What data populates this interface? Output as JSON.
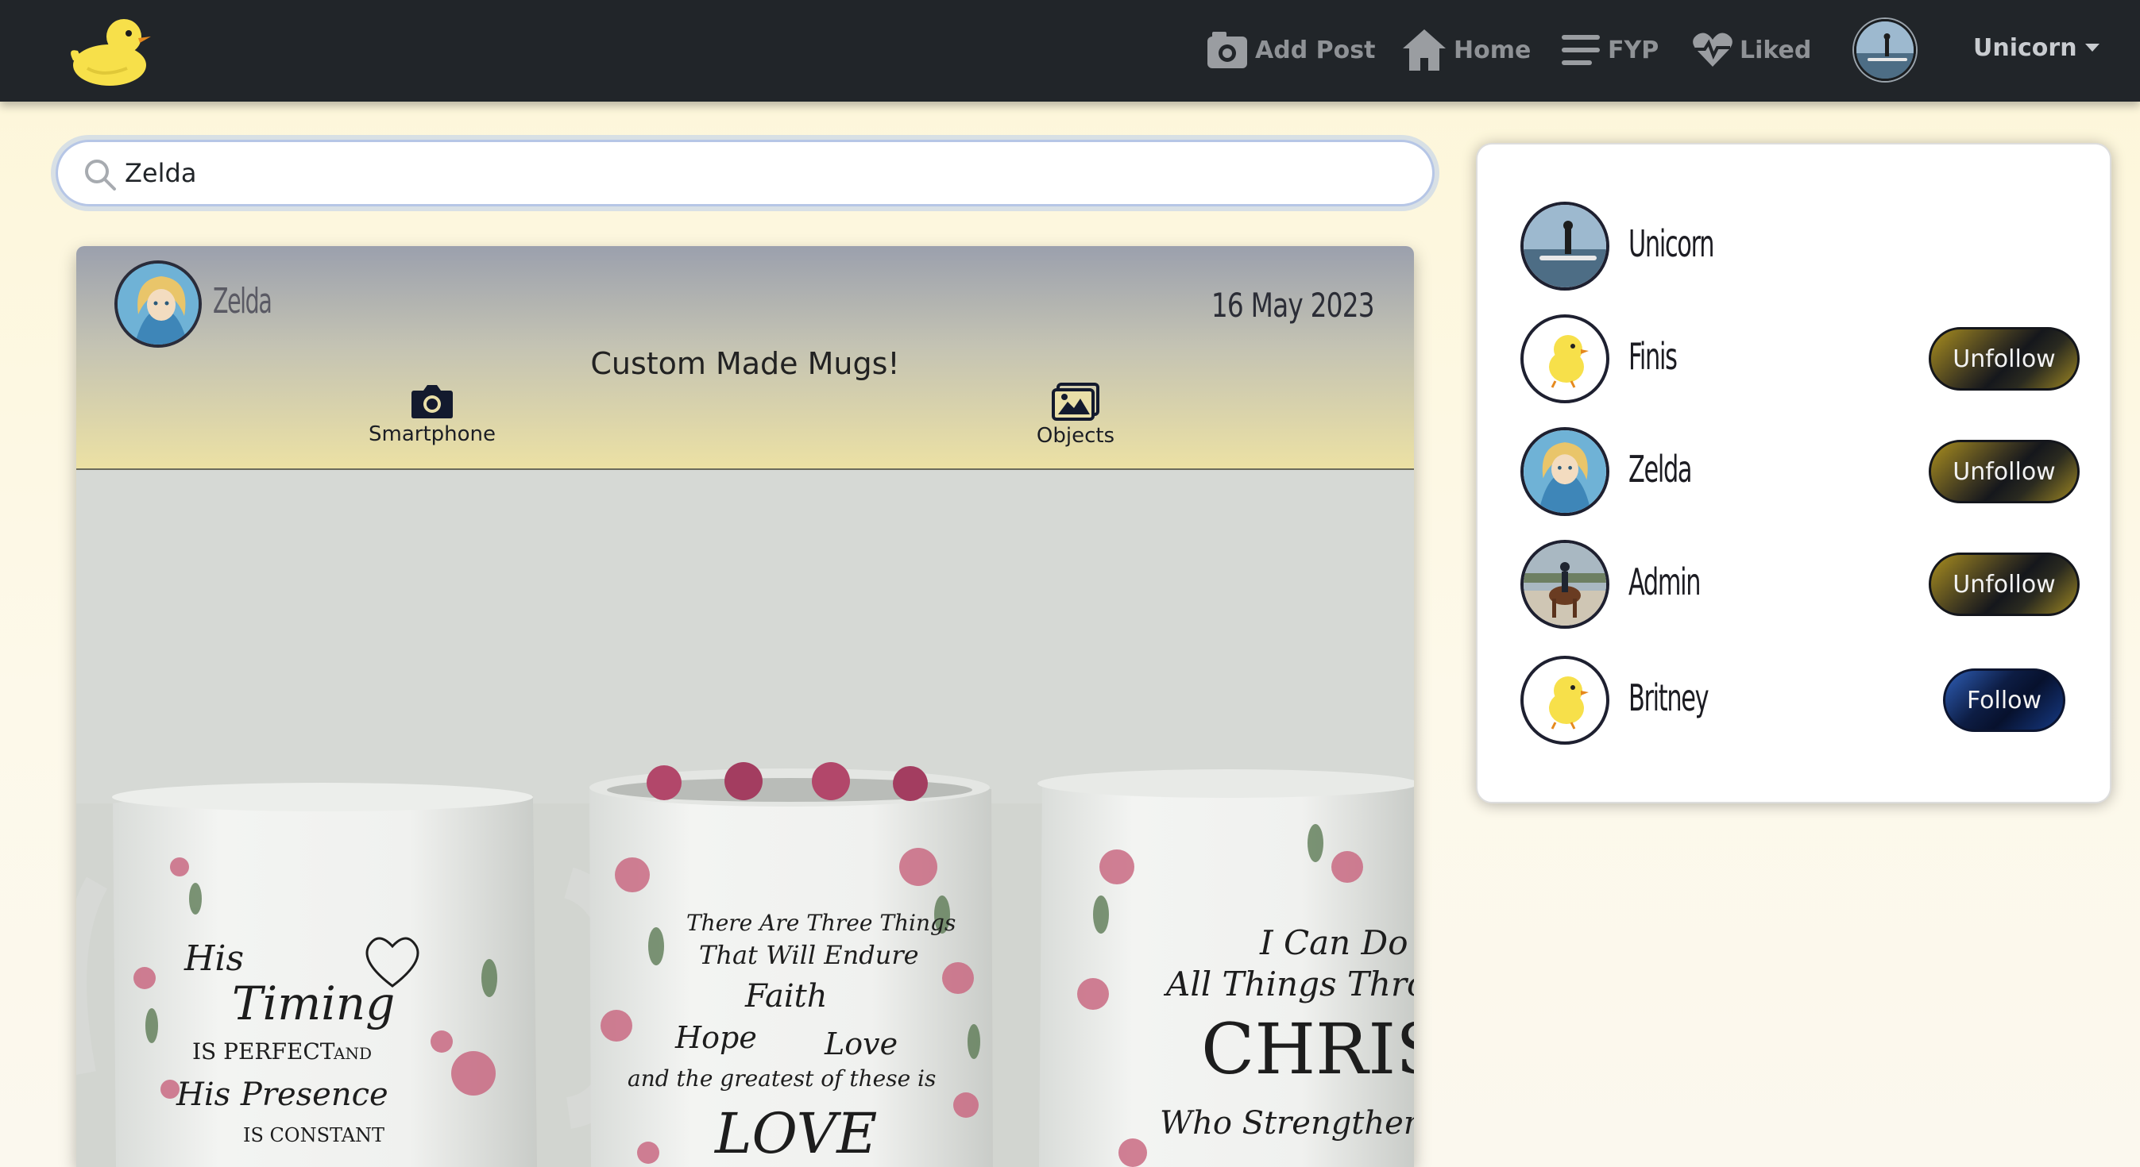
{
  "nav": {
    "add_post": "Add Post",
    "home": "Home",
    "fyp": "FYP",
    "liked": "Liked",
    "user": "Unicorn"
  },
  "search": {
    "value": "Zelda",
    "placeholder": ""
  },
  "post": {
    "author": "Zelda",
    "date": "16 May 2023",
    "title": "Custom Made Mugs!",
    "tags": [
      "Smartphone",
      "Objects"
    ],
    "mug_texts": {
      "left": [
        "His",
        "Timing",
        "IS PERFECT",
        "AND",
        "His Presence",
        "IS CONSTANT"
      ],
      "middle": [
        "There Are Three Things",
        "That Will Endure",
        "Faith",
        "Hope",
        "Love",
        "and the greatest of these is",
        "LOVE"
      ],
      "right": [
        "I Can Do",
        "All Things Through",
        "CHRIST",
        "Who Strengthens Me"
      ]
    }
  },
  "sidebar": {
    "users": [
      {
        "name": "Unicorn",
        "action": ""
      },
      {
        "name": "Finis",
        "action": "Unfollow"
      },
      {
        "name": "Zelda",
        "action": "Unfollow"
      },
      {
        "name": "Admin",
        "action": "Unfollow"
      },
      {
        "name": "Britney",
        "action": "Follow"
      }
    ]
  },
  "colors": {
    "navbar": "#212529",
    "follow": "#0d1d44",
    "unfollow": "#15171c",
    "gold": "#a98e1f"
  }
}
